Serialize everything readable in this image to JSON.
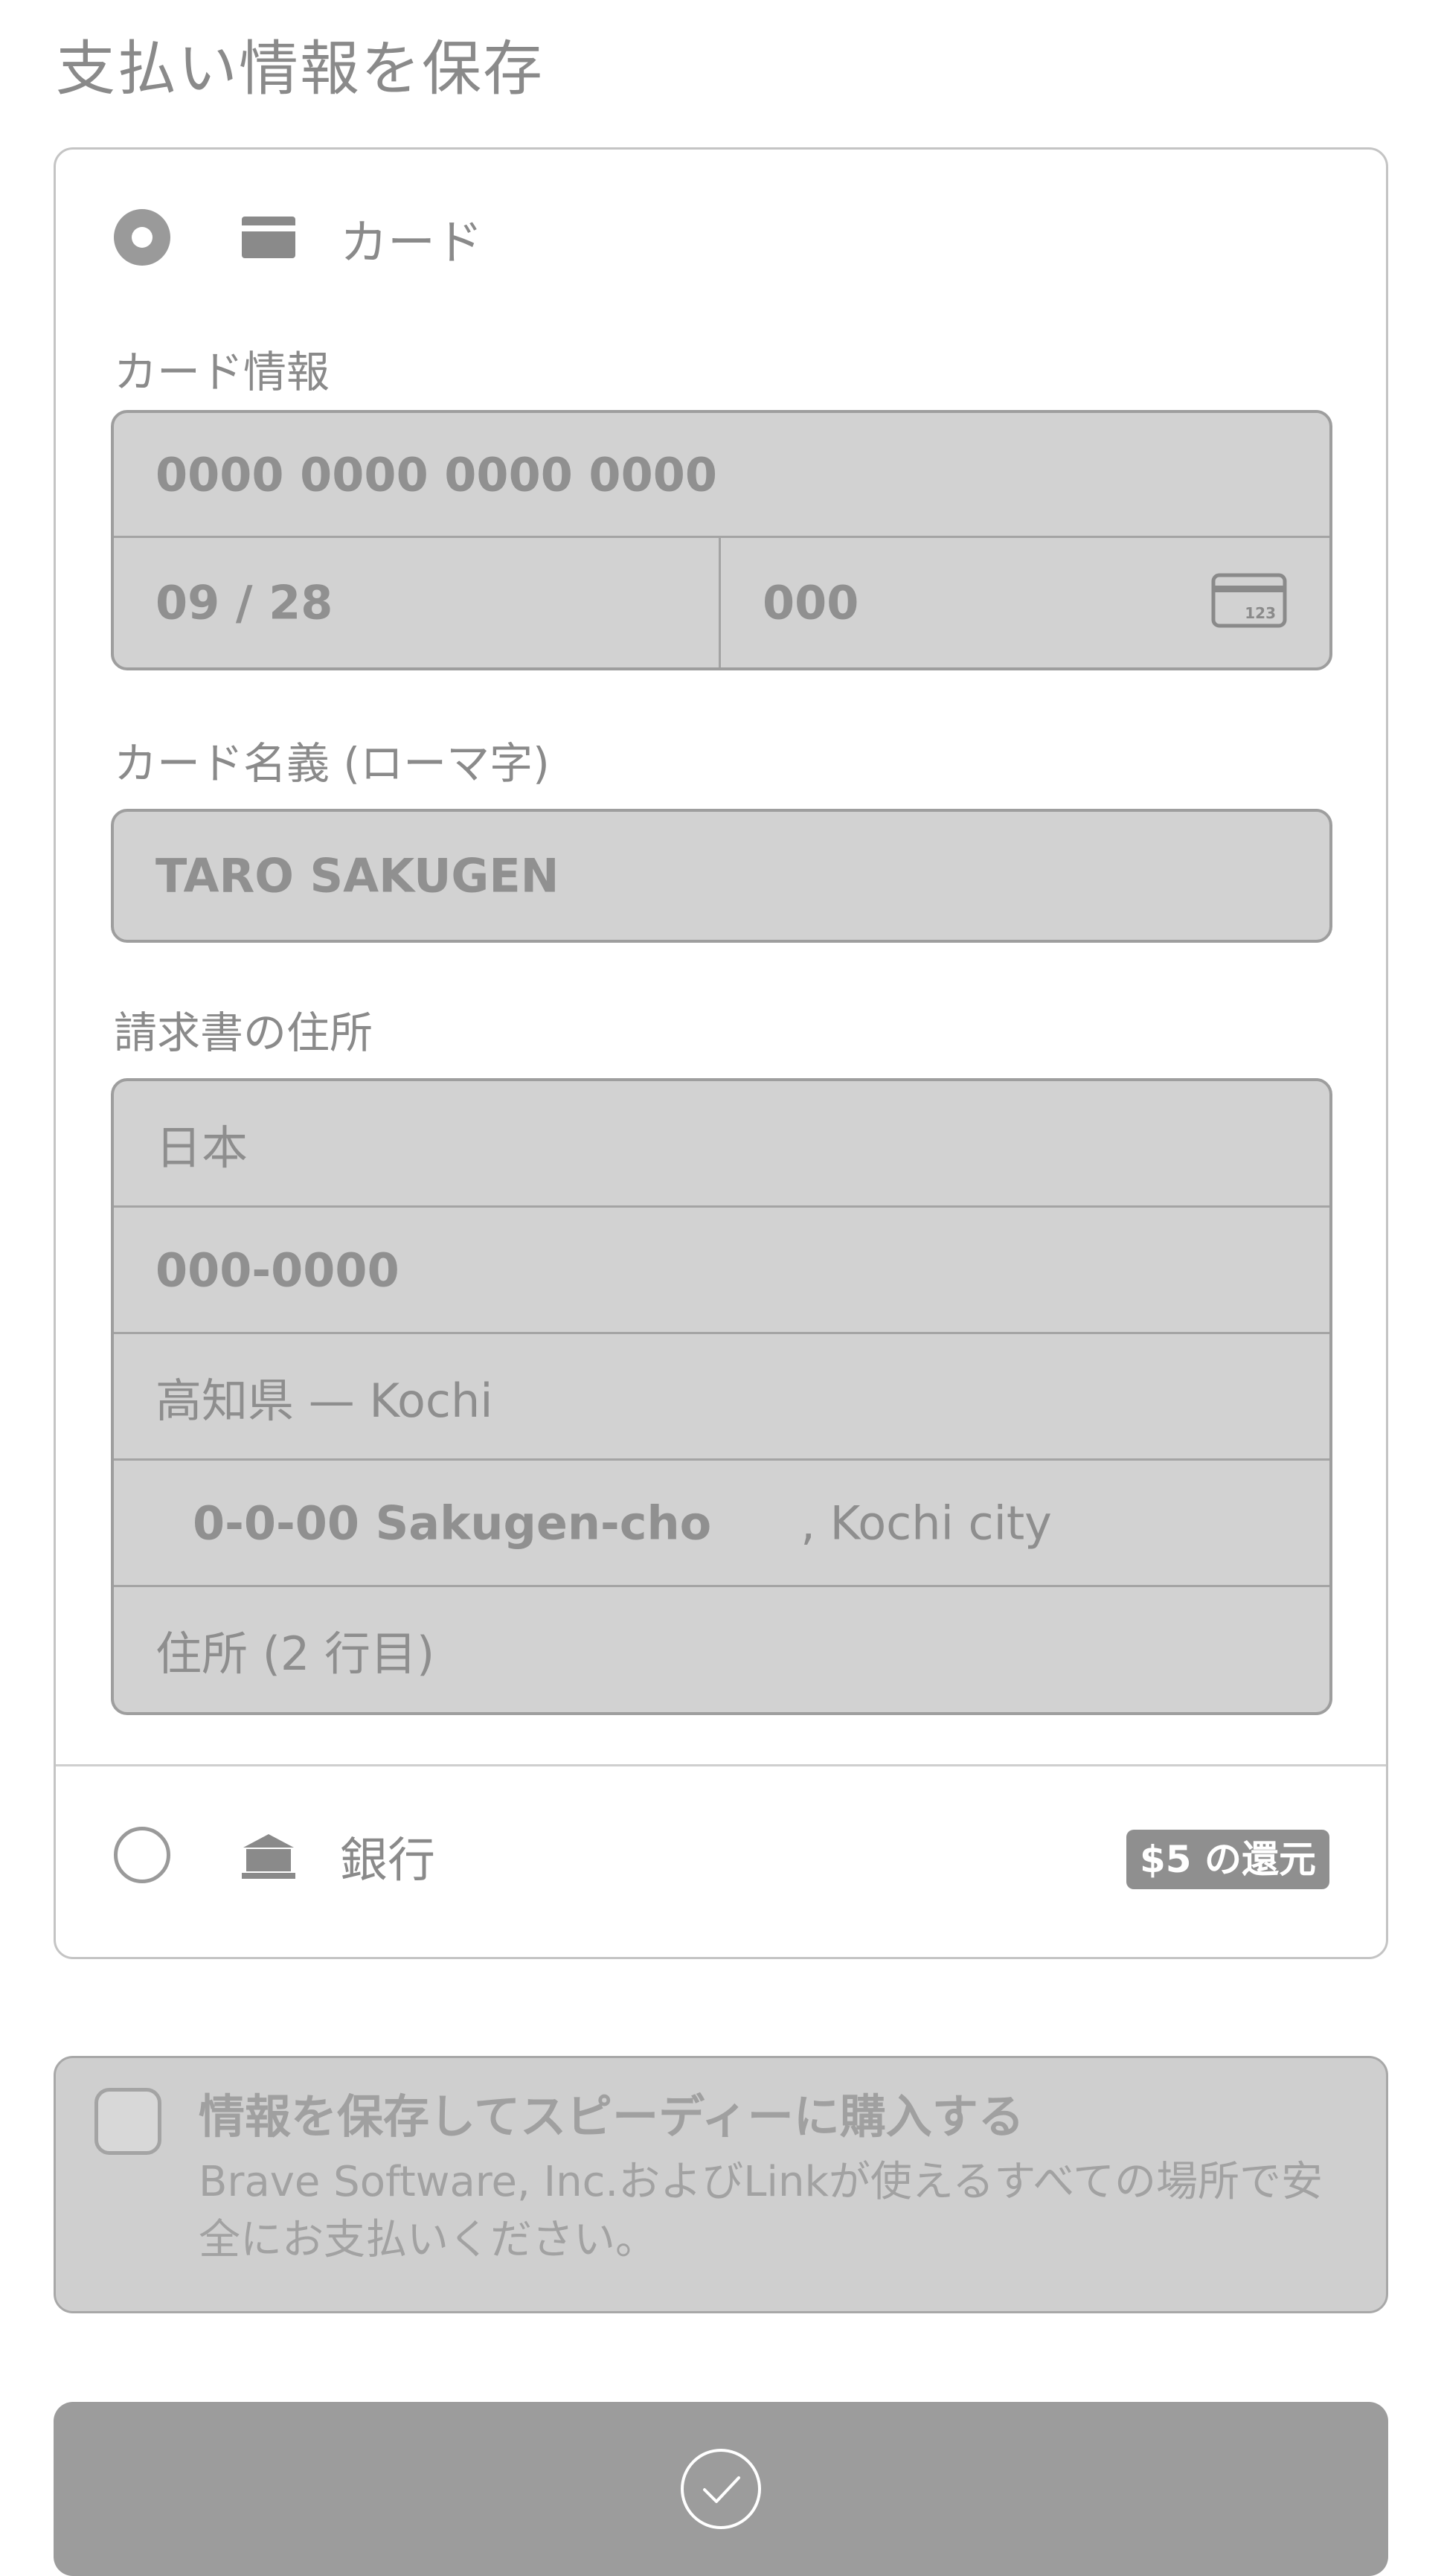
{
  "page": {
    "title": "支払い情報を保存"
  },
  "methods": {
    "card": {
      "label": "カード",
      "selected": true,
      "icon": "card-icon"
    },
    "bank": {
      "label": "銀行",
      "selected": false,
      "icon": "bank-icon",
      "badge": "$5 の還元"
    }
  },
  "card_info": {
    "label": "カード情報",
    "number": "0000 0000 0000 0000",
    "expiry": "09 / 28",
    "cvc": "000",
    "cvc_icon": "cvc-card-icon"
  },
  "cardholder": {
    "label": "カード名義 (ローマ字)",
    "name": "TARO SAKUGEN"
  },
  "billing": {
    "label": "請求書の住所",
    "country": "日本",
    "postal_code": "000-0000",
    "prefecture": "高知県 — Kochi",
    "address_line1": "0-0-00 Sakugen-cho",
    "city_suffix": ", Kochi city",
    "address_line2_placeholder": "住所 (2 行目)"
  },
  "save_info": {
    "checked": false,
    "title": "情報を保存してスピーディーに購入する",
    "description": "Brave Software, Inc.およびLinkが使えるすべての場所で安全にお支払いください。"
  },
  "submit": {
    "icon": "checkmark-circle-icon"
  },
  "colors": {
    "field_background": "#d2d2d2",
    "button_background": "#9c9c9c",
    "badge_background": "#8f8f8f",
    "text": "#8a8a8a"
  }
}
